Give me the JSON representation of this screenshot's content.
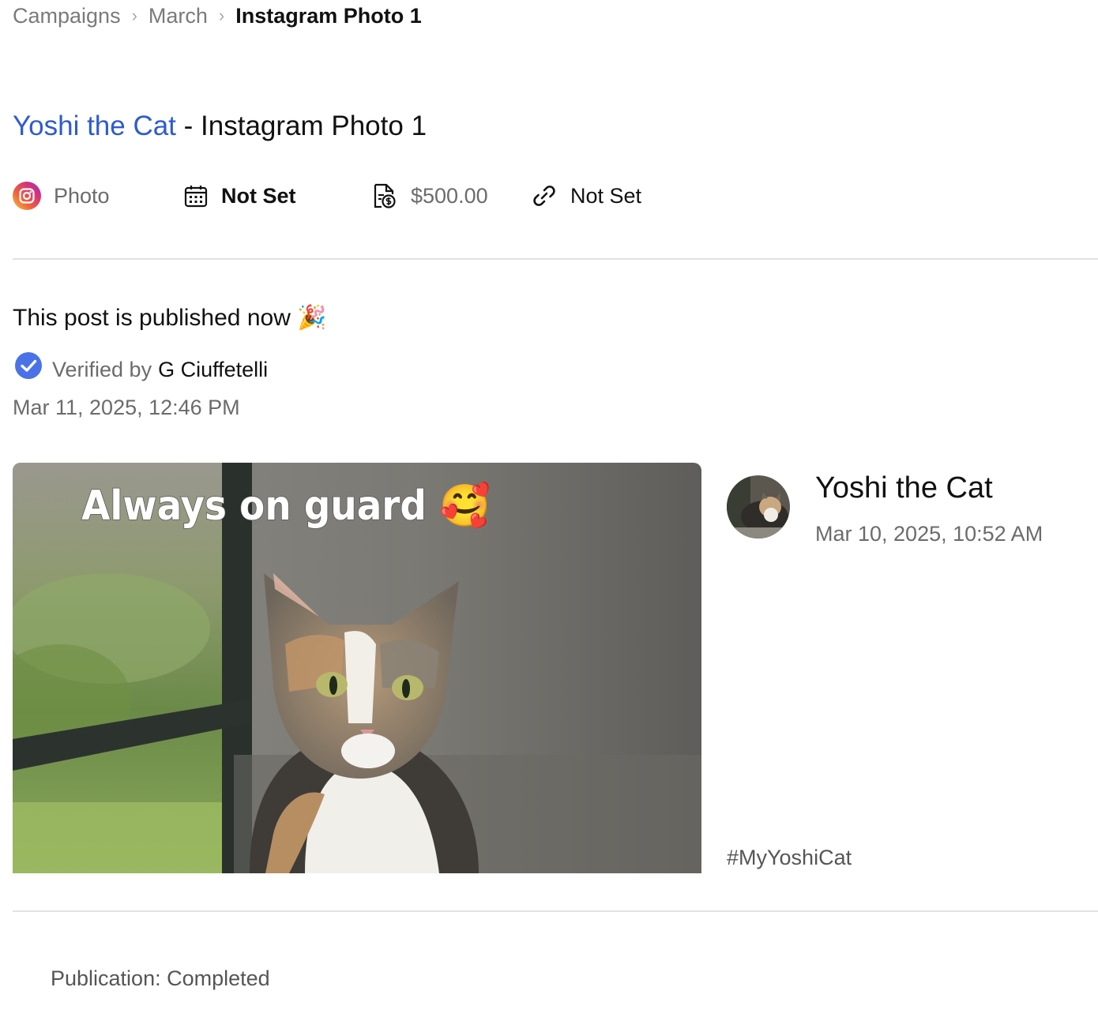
{
  "breadcrumb": {
    "items": [
      "Campaigns",
      "March"
    ],
    "current": "Instagram Photo 1",
    "separator": "›"
  },
  "title": {
    "creator": "Yoshi the Cat",
    "separator": " - ",
    "post": "Instagram Photo 1"
  },
  "meta": {
    "type_icon": "instagram-icon",
    "type": "Photo",
    "date_icon": "calendar-icon",
    "date": "Not Set",
    "price_icon": "invoice-dollar-icon",
    "price": "$500.00",
    "link_icon": "link-icon",
    "link": "Not Set"
  },
  "publication": {
    "heading": "This post is published now 🎉",
    "verified_label": "Verified by",
    "verified_by": "G Ciuffetelli",
    "timestamp": "Mar 11, 2025, 12:46 PM"
  },
  "post": {
    "overlay_text": "Always on guard 🥰",
    "author": "Yoshi the Cat",
    "posted_at": "Mar 10, 2025, 10:52 AM",
    "caption": "#MyYoshiCat"
  },
  "status": "Publication: Completed",
  "colors": {
    "link_blue": "#2f5bd0",
    "verified_blue": "#4a72e8",
    "divider": "#e2e2e2",
    "muted_text": "#6b6b6b"
  }
}
